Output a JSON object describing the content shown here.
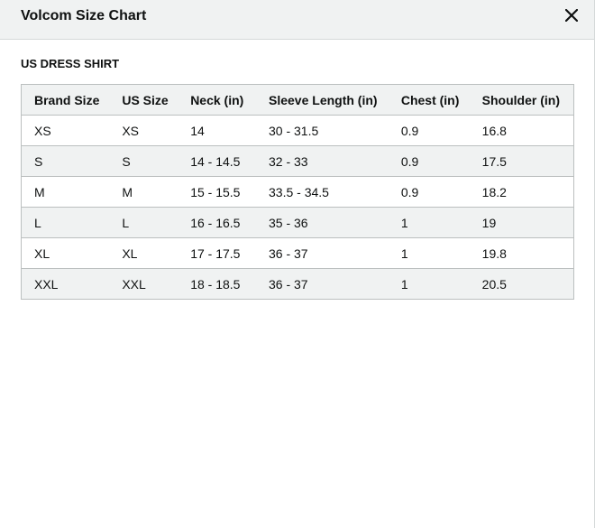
{
  "modal": {
    "title": "Volcom Size Chart",
    "close_icon": "close-icon"
  },
  "section": {
    "title": "US DRESS SHIRT"
  },
  "table": {
    "headers": [
      "Brand Size",
      "US Size",
      "Neck (in)",
      "Sleeve Length (in)",
      "Chest (in)",
      "Shoulder (in)"
    ],
    "rows": [
      [
        "XS",
        "XS",
        "14",
        "30 - 31.5",
        "0.9",
        "16.8"
      ],
      [
        "S",
        "S",
        "14 - 14.5",
        "32 - 33",
        "0.9",
        "17.5"
      ],
      [
        "M",
        "M",
        "15 - 15.5",
        "33.5 - 34.5",
        "0.9",
        "18.2"
      ],
      [
        "L",
        "L",
        "16 - 16.5",
        "35 - 36",
        "1",
        "19"
      ],
      [
        "XL",
        "XL",
        "17 - 17.5",
        "36 - 37",
        "1",
        "19.8"
      ],
      [
        "XXL",
        "XXL",
        "18 - 18.5",
        "36 - 37",
        "1",
        "20.5"
      ]
    ]
  },
  "colors": {
    "header_bg": "#f0f2f2",
    "stripe_bg": "#f0f2f2",
    "border": "#bbbfbf",
    "text": "#0f1111"
  }
}
